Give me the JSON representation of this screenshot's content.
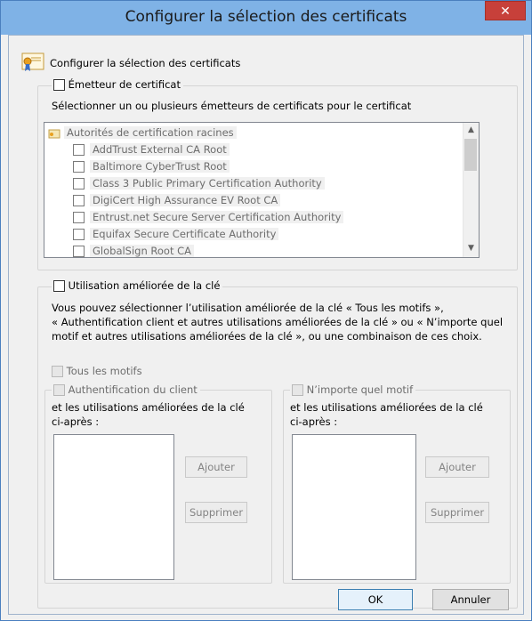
{
  "window": {
    "title": "Configurer la sélection des certificats",
    "close_glyph": "✕"
  },
  "header": {
    "label": "Configurer la sélection des certificats"
  },
  "issuer": {
    "checkbox_label": "Émetteur de certificat",
    "description": "Sélectionner un ou plusieurs émetteurs de certificats pour le certificat",
    "root_label": "Autorités de certification racines",
    "items": [
      "AddTrust External CA Root",
      "Baltimore CyberTrust Root",
      "Class 3 Public Primary Certification Authority",
      "DigiCert High Assurance EV Root CA",
      "Entrust.net Secure Server Certification Authority",
      "Equifax Secure Certificate Authority",
      "GlobalSign Root CA"
    ]
  },
  "eku": {
    "checkbox_label": "Utilisation améliorée de la clé",
    "desc_line1": "Vous pouvez sélectionner l’utilisation améliorée de la clé « Tous les motifs »,",
    "desc_line2": "« Authentification client et autres utilisations améliorées de la clé » ou « N’importe quel",
    "desc_line3": "motif et autres utilisations améliorées de la clé », ou une combinaison de ces choix.",
    "all_purposes": "Tous les motifs",
    "client_auth": {
      "label": "Authentification du client",
      "line1": "et les utilisations améliorées de la clé",
      "line2": "ci-après :",
      "add": "Ajouter",
      "remove": "Supprimer"
    },
    "any_purpose": {
      "label": "N’importe quel motif",
      "line1": "et les utilisations améliorées de la clé",
      "line2": "ci-après :",
      "add": "Ajouter",
      "remove": "Supprimer"
    }
  },
  "footer": {
    "ok": "OK",
    "cancel": "Annuler"
  }
}
